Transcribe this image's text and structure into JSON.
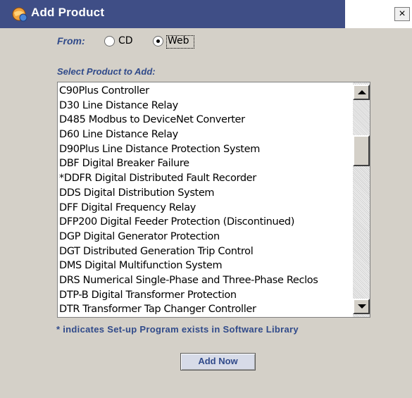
{
  "window": {
    "title": "Add Product",
    "close_glyph": "×",
    "icon": "app-globe-icon"
  },
  "source": {
    "label": "From:",
    "options": [
      {
        "label": "CD",
        "selected": false
      },
      {
        "label": "Web",
        "selected": true
      }
    ]
  },
  "products": {
    "label": "Select Product to Add:",
    "items": [
      "C90Plus Controller",
      "D30 Line Distance Relay",
      "D485 Modbus to DeviceNet Converter",
      "D60 Line Distance Relay",
      "D90Plus Line Distance Protection System",
      "DBF Digital Breaker Failure",
      "*DDFR Digital Distributed Fault Recorder",
      "DDS Digital Distribution System",
      "DFF Digital Frequency Relay",
      "DFP200 Digital Feeder Protection (Discontinued)",
      "DGP Digital Generator Protection",
      "DGT Distributed Generation Trip Control",
      "DMS Digital Multifunction System",
      "DRS Numerical Single-Phase and Three-Phase Reclos",
      "DTP-B Digital Transformer Protection",
      "DTR Transformer Tap Changer Controller"
    ]
  },
  "footnote": "* indicates Set-up Program exists in Software Library",
  "add_button": "Add Now",
  "colors": {
    "titlebar": "#3f4e86",
    "accent_text": "#304a8a",
    "dialog_bg": "#d4d0c8"
  }
}
